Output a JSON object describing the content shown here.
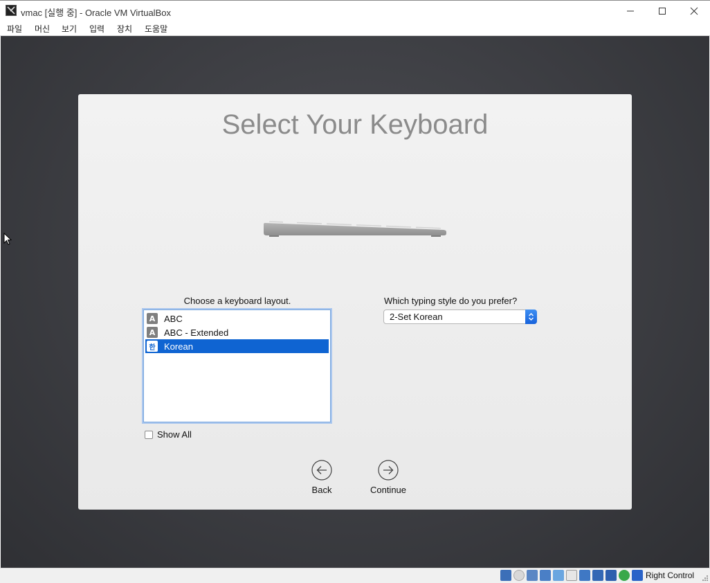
{
  "window": {
    "title": "vmac [실행 중] - Oracle VM VirtualBox"
  },
  "menu": {
    "items": [
      "파일",
      "머신",
      "보기",
      "입력",
      "장치",
      "도움말"
    ]
  },
  "installer": {
    "title": "Select Your Keyboard",
    "layout_label": "Choose a keyboard layout.",
    "layouts": [
      {
        "icon_text": "A",
        "label": "ABC",
        "selected": false
      },
      {
        "icon_text": "A",
        "label": "ABC - Extended",
        "selected": false
      },
      {
        "icon_text": "한",
        "label": "Korean",
        "selected": true
      }
    ],
    "show_all_label": "Show All",
    "show_all_checked": false,
    "style_label": "Which typing style do you prefer?",
    "style_value": "2-Set Korean",
    "back_label": "Back",
    "continue_label": "Continue"
  },
  "statusbar": {
    "host_key": "Right Control",
    "icons": [
      "hard-disk-icon",
      "optical-disk-icon",
      "audio-icon",
      "network-icon",
      "usb-icon",
      "shared-folders-icon",
      "display-icon",
      "video-capture-icon",
      "virtualization-icon",
      "mouse-integration-icon",
      "keyboard-capture-icon"
    ]
  },
  "colors": {
    "accent": "#0f64d2",
    "title_text": "#8b8b8b"
  }
}
